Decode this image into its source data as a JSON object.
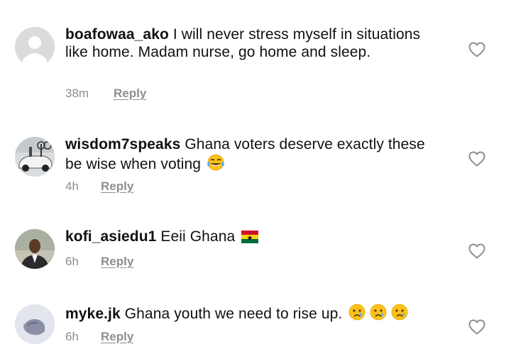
{
  "comments": [
    {
      "username": "boafowaa_ako",
      "text": "I will never stress myself in situations like home. Madam nurse, go home and sleep.",
      "time": "38m",
      "reply_label": "Reply",
      "avatar": "default-avatar-icon"
    },
    {
      "username": "wisdom7speaks",
      "text": "Ghana voters deserve exactly these be wise when voting",
      "emojis": [
        "tears-of-joy-emoji"
      ],
      "time": "4h",
      "reply_label": "Reply",
      "avatar": "car-photo-avatar"
    },
    {
      "username": "kofi_asiedu1",
      "text": "Eeii Ghana",
      "emojis": [
        "ghana-flag-emoji"
      ],
      "time": "6h",
      "reply_label": "Reply",
      "avatar": "person-photo-avatar"
    },
    {
      "username": "myke.jk",
      "text": "Ghana youth we need to rise up.",
      "emojis": [
        "crying-face-emoji",
        "crying-face-emoji",
        "crying-face-emoji"
      ],
      "time": "6h",
      "reply_label": "Reply",
      "avatar": "sketch-photo-avatar"
    }
  ],
  "colors": {
    "text": "#111111",
    "meta": "#8e8e8e",
    "heart": "#8e8e8e"
  }
}
